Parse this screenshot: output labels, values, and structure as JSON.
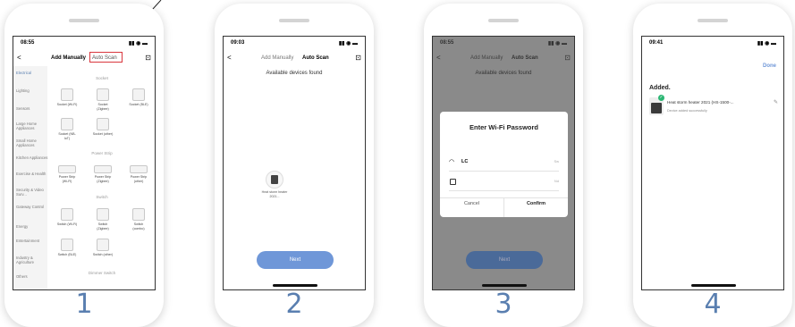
{
  "steps": [
    {
      "number": "1"
    },
    {
      "number": "2"
    },
    {
      "number": "3"
    },
    {
      "number": "4"
    }
  ],
  "screen1": {
    "time": "08:55",
    "status_icons": "▮▮ ◉ ▬",
    "back": "<",
    "tab_manual": "Add Manually",
    "tab_auto": "Auto Scan",
    "scan_icon": "⊡",
    "categories": [
      "Electrical",
      "Lighting",
      "Sensors",
      "Large Home Appliances",
      "Small Home Appliances",
      "Kitchen Appliances",
      "Exercise & Health",
      "Security & Video Surv...",
      "Gateway Control",
      "Energy",
      "Entertainment",
      "Industry & Agriculture",
      "Others"
    ],
    "sections": [
      "Socket",
      "Power Strip",
      "Switch",
      "Dimmer Switch"
    ],
    "socket_devices": [
      "Socket (Wi-Fi)",
      "Socket (Zigbee)",
      "Socket (BLE)",
      "Socket (NB-IoT)",
      "Socket (other)"
    ],
    "strip_devices": [
      "Power Strip (Wi-Fi)",
      "Power Strip (Zigbee)",
      "Power Strip (other)"
    ],
    "switch_devices": [
      "Switch (Wi-Fi)",
      "Switch (Zigbee)",
      "Switch (combo)",
      "Switch (BLE)",
      "Switch (other)"
    ]
  },
  "screen2": {
    "time": "09:03",
    "status_icons": "▮▮ ◉ ▬",
    "back": "<",
    "tab_manual": "Add Manually",
    "tab_auto": "Auto Scan",
    "scan_icon": "⊡",
    "found_label": "Available devices found",
    "device_name": "Heat storm heater 2021...",
    "next_label": "Next"
  },
  "screen3": {
    "time": "08:55",
    "status_icons": "▮▮ ◉ ▬",
    "back": "<",
    "tab_manual": "Add Manually",
    "tab_auto": "Auto Scan",
    "scan_icon": "⊡",
    "found_label": "Available devices found",
    "dialog_title": "Enter Wi-Fi Password",
    "ssid_value": "LC",
    "ssid_hint": "Sw",
    "password_hint": "Nd",
    "cancel_label": "Cancel",
    "confirm_label": "Confirm",
    "next_label": "Next"
  },
  "screen4": {
    "time": "09:41",
    "status_icons": "▮▮ ◉ ▬",
    "done_label": "Done",
    "added_label": "Added.",
    "device_name": "Heat storm heater 2021  (HS-1500-...",
    "device_status": "Device added successfully",
    "edit_icon": "✎"
  },
  "colors": {
    "accent": "#6f97d8",
    "highlight_box": "#d9363e",
    "step_number": "#5a7fb0",
    "success": "#2bb673"
  }
}
